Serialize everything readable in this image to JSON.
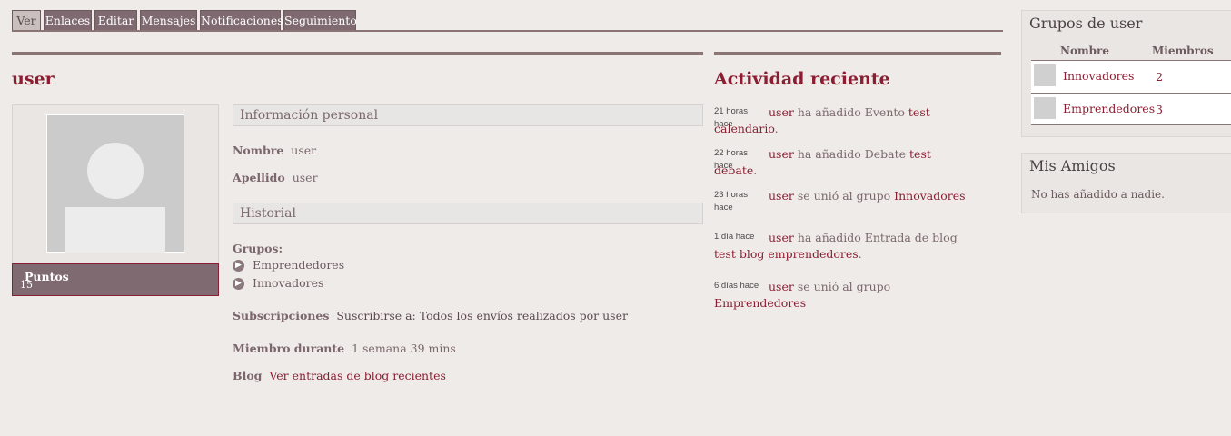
{
  "tabs": [
    {
      "label": "Ver",
      "active": true
    },
    {
      "label": "Enlaces"
    },
    {
      "label": "Editar"
    },
    {
      "label": "Mensajes"
    },
    {
      "label": "Notificaciones"
    },
    {
      "label": "Seguimiento"
    }
  ],
  "profile": {
    "username": "user",
    "points_label": "Puntos",
    "points_value": "15",
    "personal_info_heading": "Información personal",
    "first_name_label": "Nombre",
    "first_name": "user",
    "last_name_label": "Apellido",
    "last_name": "user",
    "history_heading": "Historial",
    "groups_label": "Grupos:",
    "groups": [
      "Emprendedores",
      "Innovadores"
    ],
    "subscriptions_label": "Subscripciones",
    "subscriptions_value": "Suscribirse a: Todos los envíos realizados por user",
    "member_for_label": "Miembro durante",
    "member_for_value": "1 semana 39 mins",
    "blog_label": "Blog",
    "blog_link": "Ver entradas de blog recientes"
  },
  "activity": {
    "title": "Actividad reciente",
    "items": [
      {
        "time": "21 horas hace",
        "user": "user",
        "text": " ha añadido Evento ",
        "link": "test calendario",
        "suffix": "."
      },
      {
        "time": "22 horas hace",
        "user": "user",
        "text": " ha añadido Debate ",
        "link": "test debate",
        "suffix": "."
      },
      {
        "time": "23 horas hace",
        "user": "user",
        "text": " se unió al grupo ",
        "link": "Innovadores",
        "suffix": ""
      },
      {
        "time": "1 día hace",
        "user": "user",
        "text": " ha añadido Entrada de blog ",
        "link": "test blog emprendedores",
        "suffix": "."
      },
      {
        "time": "6 días hace",
        "user": "user",
        "text": " se unió al grupo ",
        "link": "Emprendedores",
        "suffix": ""
      }
    ]
  },
  "groups_box": {
    "title": "Grupos de user",
    "col_name": "Nombre",
    "col_members": "Miembros",
    "rows": [
      {
        "name": "Innovadores",
        "members": "2"
      },
      {
        "name": "Emprendedores",
        "members": "3"
      }
    ]
  },
  "friends_box": {
    "title": "Mis Amigos",
    "empty_text": "No has añadido a nadie."
  },
  "colors": {
    "accent": "#8b1e32",
    "tab_bg": "#7e6a70",
    "page_bg": "#efebe8"
  }
}
